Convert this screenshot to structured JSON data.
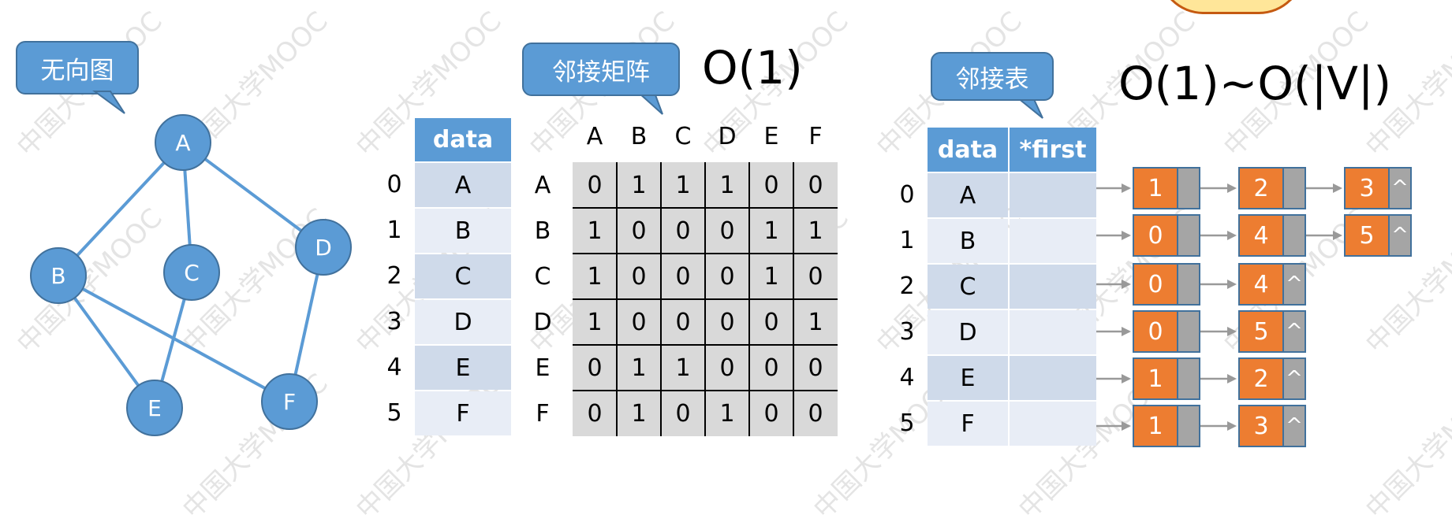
{
  "labels": {
    "graph_title": "无向图",
    "matrix_title": "邻接矩阵",
    "list_title": "邻接表",
    "matrix_complexity": "O(1)",
    "list_complexity": "O(1)~O(|V|)"
  },
  "graph": {
    "vertices": [
      "A",
      "B",
      "C",
      "D",
      "E",
      "F"
    ],
    "edges": [
      [
        "A",
        "B"
      ],
      [
        "A",
        "C"
      ],
      [
        "A",
        "D"
      ],
      [
        "B",
        "E"
      ],
      [
        "B",
        "F"
      ],
      [
        "C",
        "E"
      ],
      [
        "D",
        "F"
      ]
    ]
  },
  "vertex_table": {
    "header": "data",
    "indices": [
      "0",
      "1",
      "2",
      "3",
      "4",
      "5"
    ],
    "rows": [
      "A",
      "B",
      "C",
      "D",
      "E",
      "F"
    ]
  },
  "matrix": {
    "col_headers": [
      "A",
      "B",
      "C",
      "D",
      "E",
      "F"
    ],
    "row_headers": [
      "A",
      "B",
      "C",
      "D",
      "E",
      "F"
    ],
    "values": [
      [
        "0",
        "1",
        "1",
        "1",
        "0",
        "0"
      ],
      [
        "1",
        "0",
        "0",
        "0",
        "1",
        "1"
      ],
      [
        "1",
        "0",
        "0",
        "0",
        "1",
        "0"
      ],
      [
        "1",
        "0",
        "0",
        "0",
        "0",
        "1"
      ],
      [
        "0",
        "1",
        "1",
        "0",
        "0",
        "0"
      ],
      [
        "0",
        "1",
        "0",
        "1",
        "0",
        "0"
      ]
    ]
  },
  "adj_list": {
    "headers": [
      "data",
      "*first"
    ],
    "indices": [
      "0",
      "1",
      "2",
      "3",
      "4",
      "5"
    ],
    "rows": [
      "A",
      "B",
      "C",
      "D",
      "E",
      "F"
    ],
    "null_symbol": "^",
    "lists": [
      [
        "1",
        "2",
        "3"
      ],
      [
        "0",
        "4",
        "5"
      ],
      [
        "0",
        "4"
      ],
      [
        "0",
        "5"
      ],
      [
        "1",
        "2"
      ],
      [
        "1",
        "3"
      ]
    ]
  },
  "watermark": "中国大学MOOC",
  "colors": {
    "accent": "#5b9bd5",
    "accent_border": "#41719c",
    "node_value": "#ed7d31",
    "node_pointer": "#a5a5a5",
    "matrix_bg": "#d9d9d9"
  }
}
